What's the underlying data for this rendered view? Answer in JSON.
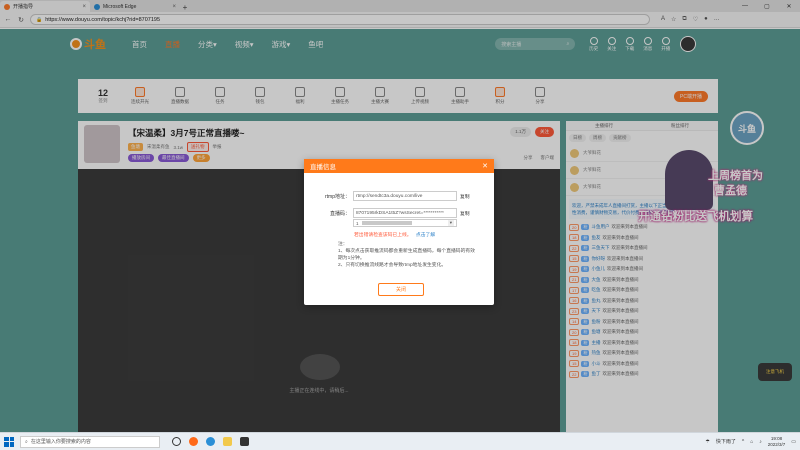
{
  "browser": {
    "tabs": [
      {
        "title": "开播指导",
        "active": true
      },
      {
        "title": "Microsoft Edge",
        "active": false
      }
    ],
    "url": "https://www.douyu.com/topic/kchj?rid=8707195"
  },
  "site": {
    "logo_text": "斗鱼",
    "nav": [
      "首页",
      "直播",
      "分类▾",
      "视频▾",
      "游戏▾",
      "鱼吧"
    ],
    "active_nav": "直播",
    "search_placeholder": "搜索主播",
    "header_icons": [
      "历史",
      "关注",
      "下载",
      "消息",
      "开播"
    ]
  },
  "toolbar": {
    "date_num": "12",
    "date_label": "签到",
    "items": [
      "连续开光",
      "直播数据",
      "任务",
      "钱包",
      "福利",
      "主播任务",
      "主播大赛",
      "上传视频",
      "主播助手",
      "积分",
      "分享"
    ],
    "pc_button": "PC端开播"
  },
  "room": {
    "title": "【宋温柔】3月7号正常直播喽~",
    "meta": [
      "鱼塘",
      "宋温柔有鱼",
      "3.1w",
      "举报"
    ],
    "badge": "送礼物",
    "tags": [
      "播放房间",
      "最佳直播间",
      "更多"
    ],
    "follow": "关注",
    "follow_count": "1.1万",
    "actions": [
      "分享",
      "客户端"
    ],
    "video_status": "主播正在连线中，请稍后..."
  },
  "chat": {
    "tabs": [
      "主播排行",
      "粉丝排行"
    ],
    "subtabs": [
      "日榜",
      "周榜",
      "贡献榜"
    ],
    "fans": [
      "大爷鲜花",
      "大爷鲜花",
      "大爷鲜花"
    ],
    "notice": "欢迎，严禁未成年人直播间打赏，主播以下正当方式诱导打赏，注意理性消费，谨慎财物交易，代价付费，请依法规范使用。",
    "messages": [
      {
        "lv": "20",
        "name": "斗鱼用户",
        "text": "欢迎来到本直播间"
      },
      {
        "lv": "18",
        "name": "鱼友",
        "text": "欢迎来到本直播间"
      },
      {
        "lv": "22",
        "name": "三鱼天下",
        "text": "欢迎来到本直播间"
      },
      {
        "lv": "15",
        "name": "你好呀",
        "text": "欢迎来到本直播间"
      },
      {
        "lv": "19",
        "name": "小鱼儿",
        "text": "欢迎来到本直播间"
      },
      {
        "lv": "21",
        "name": "大鱼",
        "text": "欢迎来到本直播间"
      },
      {
        "lv": "17",
        "name": "吃鱼",
        "text": "欢迎来到本直播间"
      },
      {
        "lv": "16",
        "name": "鱼丸",
        "text": "欢迎来到本直播间"
      },
      {
        "lv": "23",
        "name": "天下",
        "text": "欢迎来到本直播间"
      },
      {
        "lv": "14",
        "name": "鱼粉",
        "text": "欢迎来到本直播间"
      },
      {
        "lv": "20",
        "name": "鱼塘",
        "text": "欢迎来到本直播间"
      },
      {
        "lv": "18",
        "name": "主播",
        "text": "欢迎来到本直播间"
      },
      {
        "lv": "19",
        "name": "热鱼",
        "text": "欢迎来到本直播间"
      },
      {
        "lv": "15",
        "name": "小斗",
        "text": "欢迎来到本直播间"
      },
      {
        "lv": "22",
        "name": "鱼丁",
        "text": "欢迎来到本直播间"
      }
    ]
  },
  "promo": {
    "line1": "上周榜首为",
    "line2": "曹孟德",
    "line3": "开通钻粉比送飞机划算",
    "logo_badge": "斗鱼",
    "bottom_badge": "注意飞机"
  },
  "modal": {
    "title": "直播信息",
    "rtmp_label": "rtmp地址：",
    "rtmp_value": "rtmp://sendtc3a.douyu.com/live",
    "key_label": "直播码：",
    "key_value": "8707195rkDSA1t5Z?wsSecret=***********",
    "copy_label": "复制",
    "warning": "若出错请检查该码已上线。",
    "warning_link": "点击了解",
    "notes_title": "注：",
    "note1": "1、每次点击获取推流码都会重新生成直播码，每个直播码的有效期为1分钟。",
    "note2": "2、只有切换推流线路才会导致rtmp地址发生变化。",
    "close_button": "关闭"
  },
  "taskbar": {
    "search_placeholder": "在这里输入你要搜索的内容",
    "weather": "快下雨了",
    "time": "19:08",
    "date": "2022/3/7"
  }
}
